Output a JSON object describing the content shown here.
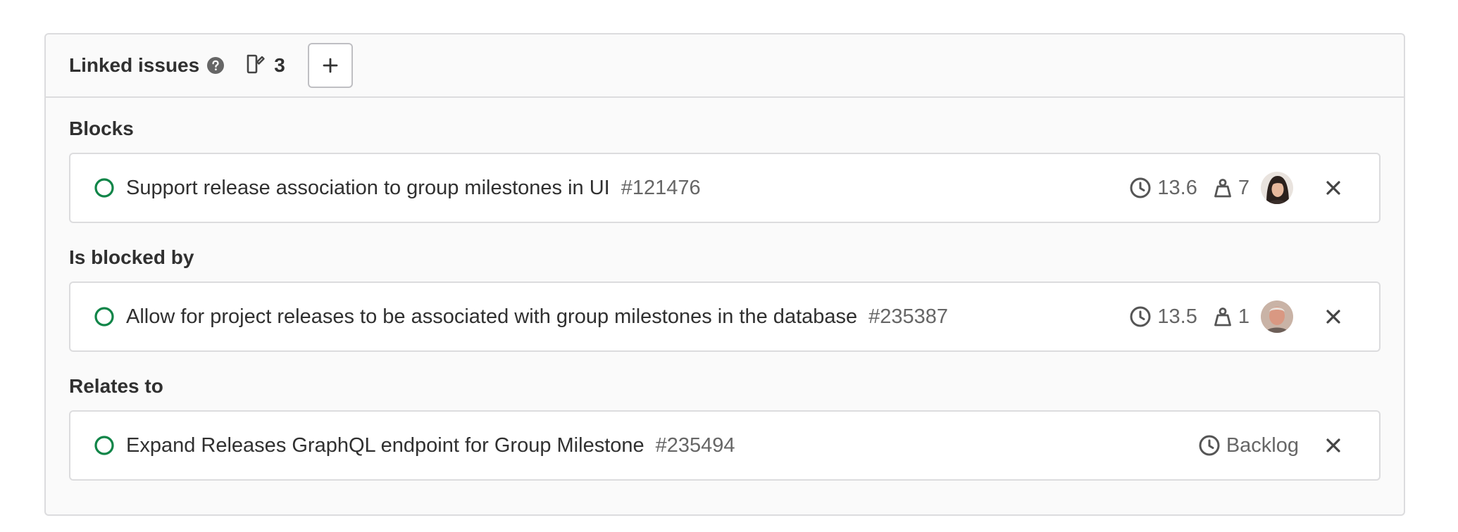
{
  "header": {
    "title": "Linked issues",
    "count": "3",
    "add_button_icon": "plus-icon"
  },
  "colors": {
    "open_status": "#108548",
    "border": "#dcdcde",
    "muted_text": "#666666"
  },
  "sections": [
    {
      "title": "Blocks",
      "issues": [
        {
          "title": "Support release association to group milestones in UI",
          "ref": "#121476",
          "milestone": "13.6",
          "weight": "7",
          "avatar": "avatar-woman"
        }
      ]
    },
    {
      "title": "Is blocked by",
      "issues": [
        {
          "title": "Allow for project releases to be associated with group milestones in the database",
          "ref": "#235387",
          "milestone": "13.5",
          "weight": "1",
          "avatar": "avatar-man"
        }
      ]
    },
    {
      "title": "Relates to",
      "issues": [
        {
          "title": "Expand Releases GraphQL endpoint for Group Milestone",
          "ref": "#235494",
          "milestone": "Backlog"
        }
      ]
    }
  ]
}
